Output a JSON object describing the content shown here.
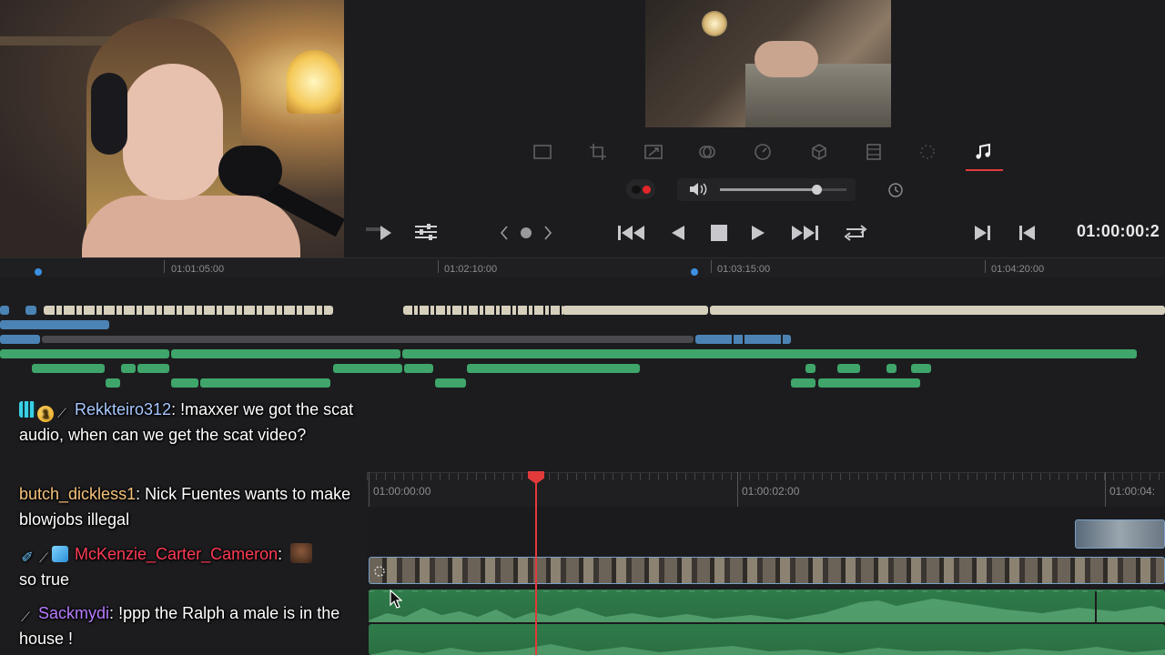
{
  "upper_ruler": {
    "labels": [
      "01:01:05:00",
      "01:02:10:00",
      "01:03:15:00",
      "01:04:20:00"
    ]
  },
  "transport": {
    "timecode": "01:00:00:2"
  },
  "lower_ruler": {
    "labels": [
      "01:00:00:00",
      "01:00:02:00",
      "01:00:04:"
    ]
  },
  "audio": {
    "volume_level": 0.76
  },
  "inspector_tools": [
    "transform-icon",
    "crop-icon",
    "dynamic-zoom-icon",
    "composite-icon",
    "speed-icon",
    "stabilization-icon",
    "lens-correction-icon",
    "retime-icon",
    "audio-icon"
  ],
  "active_tool": "audio-icon",
  "chat": {
    "messages": [
      {
        "user": "Rekkteiro312",
        "text": "!maxxer we got the scat audio, when can we get the scat video?",
        "color": "#a8c8ff",
        "badges": [
          "grid-badge",
          "coin-badge",
          "pen-badge"
        ]
      },
      {
        "user": "butch_dickless1",
        "text": "Nick Fuentes wants to make blowjobs illegal",
        "color": "#f5c27a",
        "badges": []
      },
      {
        "user": "McKenzie_Carter_Cameron",
        "text": "so true",
        "color": "#ff3b55",
        "badges": [
          "sword-badge",
          "pen-badge",
          "cube-badge"
        ]
      },
      {
        "user": "Sackmydi",
        "text": "!ppp the Ralph a male is in the house !",
        "color": "#b77cff",
        "badges": [
          "pen-badge"
        ]
      }
    ]
  },
  "colors": {
    "playhead": "#e23a3a",
    "audio_clip": "#3fa56a",
    "video_clip_border": "#7aa0c8",
    "record": "#e2262b"
  }
}
